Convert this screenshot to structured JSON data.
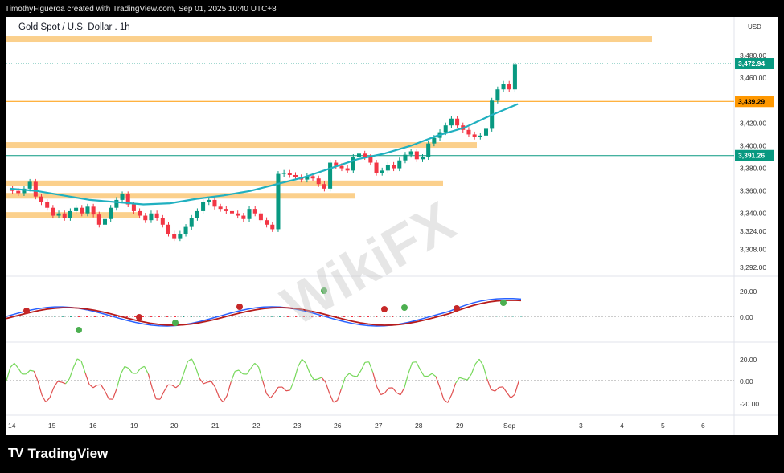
{
  "header": {
    "text": "TimothyFigueroa created with TradingView.com, Sep 01, 2025 10:40 UTC+8"
  },
  "footer": {
    "brand": "TradingView"
  },
  "watermark": {
    "text": "WikiFX"
  },
  "colors": {
    "up": "#089981",
    "down": "#f23645",
    "ma": "#20b0c0",
    "zone": "#fbd08c",
    "last_price_tag": "#089981",
    "orange_tag": "#ff9800",
    "green_tag": "#089981",
    "macd_fast": "#2962ff",
    "macd_slow": "#b71c1c",
    "macd_green": "#4caf50",
    "rsi_up": "#76d85a",
    "rsi_down": "#e05050"
  },
  "chart_data": {
    "type": "candlestick",
    "title": "Gold Spot / U.S. Dollar . 1h",
    "price_unit": "USD",
    "ylim": [
      3285,
      3500
    ],
    "price_ticks": [
      "3,480.00",
      "3,460.00",
      "3,420.00",
      "3,400.00",
      "3,380.00",
      "3,360.00",
      "3,340.00",
      "3,324.00",
      "3,308.00",
      "3,292.00"
    ],
    "x_ticks": [
      "14",
      "15",
      "16",
      "19",
      "20",
      "21",
      "22",
      "23",
      "26",
      "27",
      "28",
      "29",
      "Sep",
      "3",
      "4",
      "5",
      "6"
    ],
    "price_labels": [
      {
        "value": 3472.94,
        "text": "3,472.94",
        "color": "#089981"
      },
      {
        "value": 3439.29,
        "text": "3,439.29",
        "color": "#ff9800"
      },
      {
        "value": 3391.26,
        "text": "3,391.26",
        "color": "#089981"
      }
    ],
    "zones": [
      3495,
      3401,
      3367,
      3356,
      3339
    ],
    "closes": [
      3360,
      3358,
      3362,
      3368,
      3355,
      3350,
      3345,
      3338,
      3340,
      3336,
      3342,
      3345,
      3340,
      3346,
      3339,
      3330,
      3335,
      3345,
      3352,
      3357,
      3348,
      3342,
      3338,
      3334,
      3340,
      3336,
      3330,
      3322,
      3318,
      3322,
      3328,
      3336,
      3342,
      3350,
      3352,
      3346,
      3344,
      3342,
      3340,
      3338,
      3335,
      3344,
      3340,
      3334,
      3330,
      3326,
      3375,
      3376,
      3374,
      3372,
      3370,
      3373,
      3371,
      3366,
      3362,
      3385,
      3382,
      3380,
      3378,
      3390,
      3393,
      3390,
      3385,
      3376,
      3378,
      3383,
      3380,
      3387,
      3392,
      3395,
      3388,
      3390,
      3402,
      3407,
      3412,
      3418,
      3424,
      3418,
      3414,
      3410,
      3408,
      3409,
      3415,
      3440,
      3450,
      3455,
      3450,
      3472
    ],
    "ma": [
      3362,
      3360,
      3356,
      3352,
      3350,
      3348,
      3349,
      3353,
      3356,
      3360,
      3366,
      3372,
      3380,
      3388,
      3393,
      3400,
      3409,
      3416,
      3427,
      3437
    ],
    "macd_ticks": [
      "20.00",
      "0.00"
    ],
    "rsi_ticks": [
      "20.00",
      "0.00",
      "-20.00"
    ]
  }
}
